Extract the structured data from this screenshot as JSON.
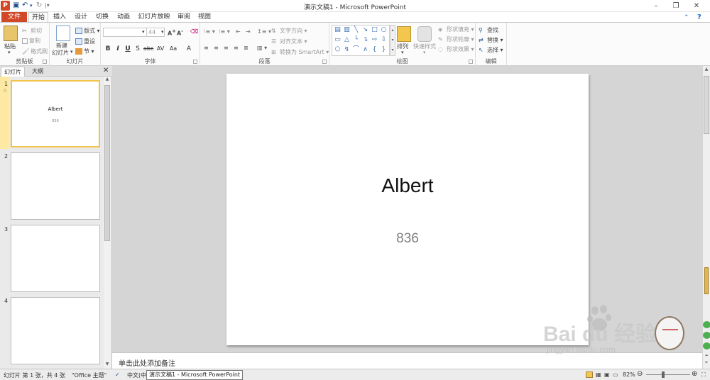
{
  "window": {
    "title": "演示文稿1 - Microsoft PowerPoint",
    "app_icon": "P"
  },
  "tabs": [
    "文件",
    "开始",
    "插入",
    "设计",
    "切换",
    "动画",
    "幻灯片放映",
    "审阅",
    "视图"
  ],
  "ribbon": {
    "clipboard": {
      "label": "剪贴板",
      "paste": "粘贴",
      "cut": "剪切",
      "copy": "复制",
      "format_painter": "格式刷"
    },
    "slides": {
      "label": "幻灯片",
      "new_slide_1": "新建",
      "new_slide_2": "幻灯片",
      "layout": "版式",
      "reset": "重设",
      "section": "节"
    },
    "font": {
      "label": "字体",
      "size": "44"
    },
    "paragraph": {
      "label": "段落",
      "text_direction": "文字方向",
      "align_text": "对齐文本",
      "smartart": "转换为 SmartArt"
    },
    "drawing": {
      "label": "绘图",
      "arrange": "排列",
      "quick_styles": "快速样式",
      "shape_fill": "形状填充",
      "shape_outline": "形状轮廓",
      "shape_effects": "形状效果"
    },
    "editing": {
      "label": "编辑",
      "find": "查找",
      "replace": "替换",
      "select": "选择"
    }
  },
  "panel": {
    "tab_slides": "幻灯片",
    "tab_outline": "大纲"
  },
  "thumbnails": [
    {
      "num": "1",
      "title": "Albert",
      "subtitle": "836"
    },
    {
      "num": "2"
    },
    {
      "num": "3"
    },
    {
      "num": "4"
    }
  ],
  "slide": {
    "title": "Albert",
    "subtitle": "836"
  },
  "notes": {
    "placeholder": "单击此处添加备注"
  },
  "status": {
    "slide_info": "幻灯片 第 1 张，共 4 张",
    "theme": "\"Office 主题\"",
    "language": "中文(中",
    "zoom": "82%"
  },
  "taskbar_tooltip": "演示文稿1 - Microsoft PowerPoint",
  "watermark": {
    "text": "Bai du 经验",
    "url": "jingyan.baidu.com"
  },
  "colors": {
    "accent": "#d24726",
    "selection": "#f2c34b"
  }
}
